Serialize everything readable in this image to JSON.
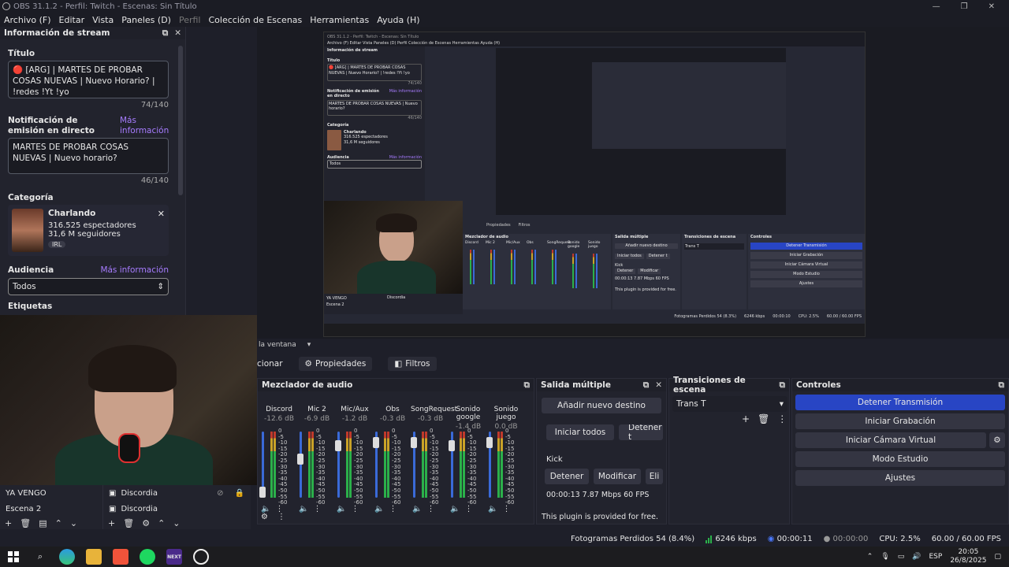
{
  "window": {
    "title": "OBS 31.1.2 - Perfil: Twitch - Escenas: Sin Título",
    "controls": [
      "—",
      "❐",
      "✕"
    ]
  },
  "menu": [
    "Archivo (F)",
    "Editar",
    "Vista",
    "Paneles (D)",
    "Perfil",
    "Colección de Escenas",
    "Herramientas",
    "Ayuda (H)"
  ],
  "stream_info": {
    "header": "Información de stream",
    "title_label": "Título",
    "title_value": "🔴 [ARG] | MARTES DE PROBAR COSAS NUEVAS | Nuevo Horario? | !redes !Yt !yo",
    "title_count": "74/140",
    "notif_label": "Notificación de emisión en directo",
    "notif_link": "Más información",
    "notif_value": "MARTES DE PROBAR COSAS NUEVAS | Nuevo horario?",
    "notif_count": "46/140",
    "category_label": "Categoría",
    "category_name": "Charlando",
    "category_viewers": "316.525 espectadores",
    "category_followers": "31,6 M seguidores",
    "category_tag": "IRL",
    "audience_label": "Audiencia",
    "audience_link": "Más información",
    "audience_value": "Todos",
    "next_label": "Etiquetas"
  },
  "scenes": {
    "items": [
      "YA VENGO",
      "Escena 2"
    ]
  },
  "sources": {
    "items": [
      "Discordia",
      "Discordia"
    ]
  },
  "preview_bar": {
    "label": "la ventana"
  },
  "source_toolbar": {
    "left_label": "cionar",
    "properties": "Propiedades",
    "filters": "Filtros"
  },
  "mixer": {
    "header": "Mezclador de audio",
    "channels": [
      {
        "name": "Discord",
        "db": "-12.6 dB",
        "level": 0.0
      },
      {
        "name": "Mic 2",
        "db": "-6.9 dB",
        "level": 0.6
      },
      {
        "name": "Mic/Aux",
        "db": "-1.2 dB",
        "level": 0.85
      },
      {
        "name": "Obs",
        "db": "-0.3 dB",
        "level": 0.9
      },
      {
        "name": "SongRequest",
        "db": "-0.3 dB",
        "level": 0.9
      },
      {
        "name": "Sonido google",
        "db": "-1.4 dB",
        "level": 0.84
      },
      {
        "name": "Sonido juego",
        "db": "0.0 dB",
        "level": 0.9
      }
    ],
    "scale": [
      "0",
      "-5",
      "-10",
      "-15",
      "-20",
      "-25",
      "-30",
      "-35",
      "-40",
      "-45",
      "-50",
      "-55",
      "-60"
    ]
  },
  "multi_output": {
    "header": "Salida múltiple",
    "add_button": "Añadir nuevo destino",
    "start_all": "Iniciar todos",
    "stop_all": "Detener t",
    "target_name": "Kick",
    "stop": "Detener",
    "modify": "Modificar",
    "delete": "Eli",
    "stats": "00:00:13  7.87 Mbps  60 FPS",
    "footer": "This plugin is provided for free."
  },
  "transitions": {
    "header": "Transiciones de escena",
    "selected": "Trans T"
  },
  "controls": {
    "header": "Controles",
    "buttons": [
      "Detener Transmisión",
      "Iniciar Grabación",
      "Iniciar Cámara Virtual",
      "Modo Estudio",
      "Ajustes"
    ]
  },
  "status": {
    "dropped": "Fotogramas Perdidos 54 (8.4%)",
    "bitrate": "6246 kbps",
    "stream_time": "00:00:11",
    "rec_time": "00:00:00",
    "cpu": "CPU: 2.5%",
    "fps": "60.00 / 60.00 FPS",
    "color_ok": "#2bb04a"
  },
  "taskbar": {
    "lang": "ESP",
    "time": "20:05",
    "date": "26/8/2025",
    "apps": [
      "windows-icon",
      "search-icon",
      "edge-icon",
      "explorer-icon",
      "brave-icon",
      "spotify-icon",
      "next-icon",
      "obs-icon"
    ],
    "next_label": "NEXT"
  },
  "nested": {
    "stop_label": "Detener Transmisión",
    "rec_label": "Iniciar Grabación",
    "vcam_label": "Iniciar Cámara Virtual",
    "studio_label": "Modo Estudio",
    "settings_label": "Ajustes",
    "mixer_label": "Mezclador de audio",
    "multi_label": "Salida múltiple",
    "trans_label": "Transiciones de escena",
    "controls_label": "Controles",
    "trans_selected": "Trans T",
    "add_dest": "Añadir nuevo destino",
    "start_all": "Iniciar todos",
    "stop_short": "Detener t",
    "kick": "Kick",
    "stop": "Detener",
    "modify": "Modificar",
    "stats": "00:00:13  7.87 Mbps  60 FPS",
    "plugin": "This plugin is provided for free.",
    "info_header": "Información de stream",
    "title_label": "Título",
    "title_value": "🔴 [ARG] | MARTES DE PROBAR COSAS NUEVAS | Nuevo Horario? | !redes !Yt !yo",
    "count1": "74/140",
    "notif_label": "Notificación de emisión en directo",
    "more_info": "Más información",
    "notif_value": "MARTES DE PROBAR COSAS NUEVAS | Nuevo horario?",
    "count2": "46/140",
    "cat_label": "Categoría",
    "cat_name": "Charlando",
    "cat_viewers": "316.525 espectadores",
    "cat_followers": "31,6 M seguidores",
    "aud_label": "Audiencia",
    "aud_value": "Todos",
    "scene1": "YA VENGO",
    "scene2": "Escena 2",
    "source1": "Discordia",
    "status_dropped": "Fotogramas Perdidos 54 (8.3%)",
    "status_kbps": "6246 kbps",
    "status_time": "00:00:10",
    "status_cpu": "CPU: 2.5%",
    "status_fps": "60.00 / 60.00 FPS",
    "menu_text": "Archivo (F)  Editar  Vista  Paneles (D)  Perfil  Colección de Escenas  Herramientas  Ayuda (H)",
    "title_text": "OBS 31.1.2 - Perfil: Twitch - Escenas: Sin Título",
    "props": "Propiedades",
    "filters": "Filtros",
    "channels": [
      "Discord",
      "Mic 2",
      "Mic/Aux",
      "Obs",
      "SongRequest",
      "Sonido google",
      "Sonido juego"
    ]
  }
}
